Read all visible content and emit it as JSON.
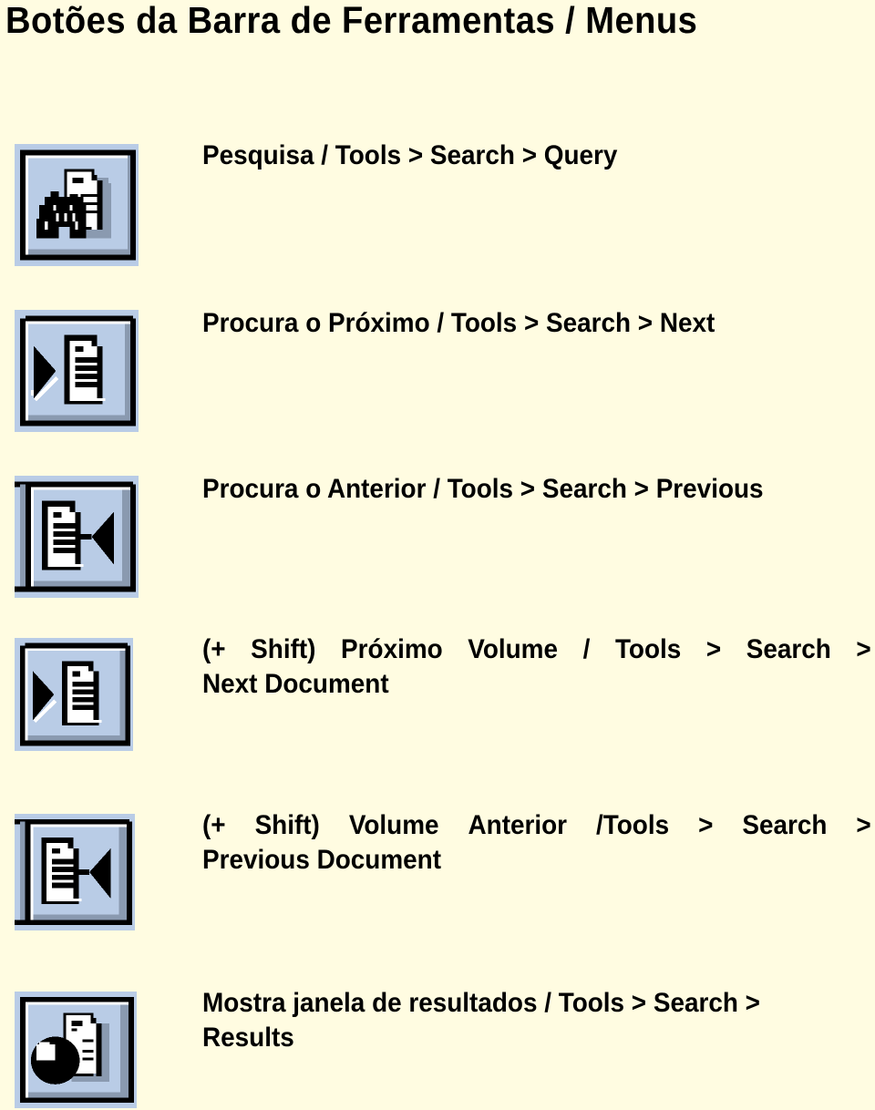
{
  "page": {
    "title": "Botões da Barra de Ferramentas / Menus",
    "background_color": "#FFFCE1",
    "button_color": "#B9CCE6"
  },
  "items": [
    {
      "icon": "binoculars-document-icon",
      "line1": "Pesquisa / Tools > Search > Query",
      "line2": ""
    },
    {
      "icon": "next-arrow-document-icon",
      "line1": "Procura o Próximo / Tools > Search > Next",
      "line2": ""
    },
    {
      "icon": "document-previous-arrow-icon",
      "line1": "Procura o Anterior / Tools > Search > Previous",
      "line2": ""
    },
    {
      "icon": "next-arrow-document-icon",
      "line1_words": [
        "(+",
        "Shift)",
        "Próximo",
        "Volume",
        "/",
        "Tools",
        ">",
        "Search",
        ">"
      ],
      "line2": "Next Document"
    },
    {
      "icon": "document-previous-arrow-icon",
      "line1_words": [
        "(+",
        "Shift)",
        "Volume",
        "Anterior",
        "/Tools",
        ">",
        "Search",
        ">"
      ],
      "line2": "Previous Document"
    },
    {
      "icon": "results-window-icon",
      "line1": "Mostra janela de resultados / Tools > Search >",
      "line2": "Results"
    }
  ]
}
